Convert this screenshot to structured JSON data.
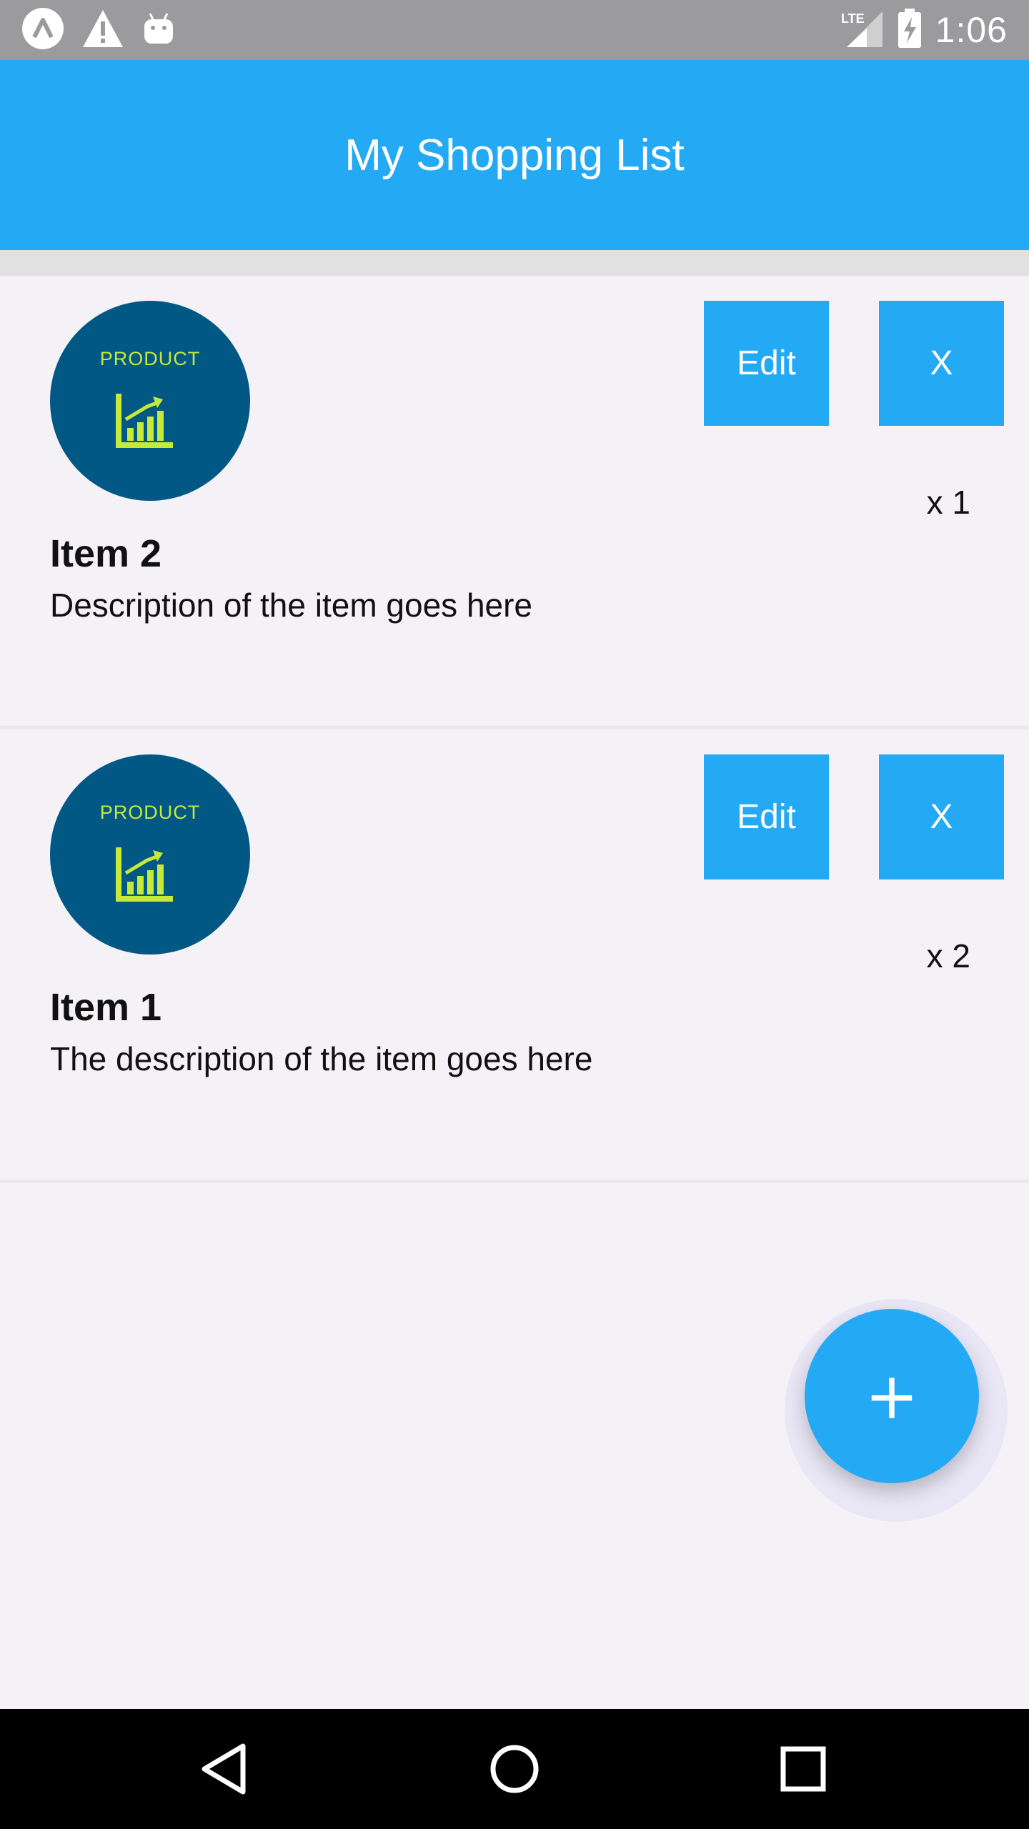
{
  "status_bar": {
    "time": "1:06",
    "network": "LTE",
    "icons": [
      "app-launcher-icon",
      "warning-icon",
      "android-icon",
      "signal-icon",
      "battery-charging-icon"
    ]
  },
  "app_bar": {
    "title": "My Shopping List",
    "color": "#24a9f5"
  },
  "items": [
    {
      "name": "Item 2",
      "description": "Description of the item goes here",
      "quantity": "x 1",
      "image_label": "PRODUCT",
      "edit_label": "Edit",
      "remove_label": "X"
    },
    {
      "name": "Item 1",
      "description": "The description of the item goes here",
      "quantity": "x 2",
      "image_label": "PRODUCT",
      "edit_label": "Edit",
      "remove_label": "X"
    }
  ],
  "fab": {
    "label": "+",
    "icon": "add-icon"
  },
  "nav_bar": {
    "icons": [
      "back-icon",
      "home-icon",
      "recents-icon"
    ]
  },
  "colors": {
    "accent": "#24a9f5",
    "avatar_bg": "#015885",
    "avatar_fg": "#c7ea3a",
    "background": "#f5f2f7"
  }
}
